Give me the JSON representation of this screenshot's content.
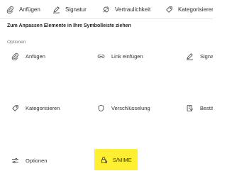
{
  "toolbar": {
    "items": [
      {
        "label": "Anfügen",
        "icon": "paperclip-icon"
      },
      {
        "label": "Signatur",
        "icon": "pen-signature-icon"
      },
      {
        "label": "Vertraulichkeit",
        "icon": "sensitivity-icon"
      },
      {
        "label": "Kategorisieren",
        "icon": "tag-icon"
      }
    ]
  },
  "instruction": "Zum Anpassen Elemente in Ihre Symbolleiste ziehen",
  "section": {
    "label": "Optionen",
    "commands": [
      {
        "label": "Anfügen",
        "icon": "paperclip-icon"
      },
      {
        "label": "Link einfügen",
        "icon": "link-icon"
      },
      {
        "label": "Signatur",
        "icon": "pen-signature-icon"
      },
      {
        "label": "Kategorisieren",
        "icon": "tag-icon"
      },
      {
        "label": "Verschlüsselung",
        "icon": "shield-icon"
      },
      {
        "label": "Bestätigung",
        "icon": "receipt-icon"
      },
      {
        "label": "Optionen",
        "icon": "sliders-icon"
      },
      {
        "label": "S/MIME",
        "icon": "lock-shield-icon",
        "highlighted": true
      }
    ]
  },
  "colors": {
    "highlight": "#ffef33",
    "text": "#242424",
    "muted": "#7a7a7a",
    "divider": "#e6e6e6"
  }
}
